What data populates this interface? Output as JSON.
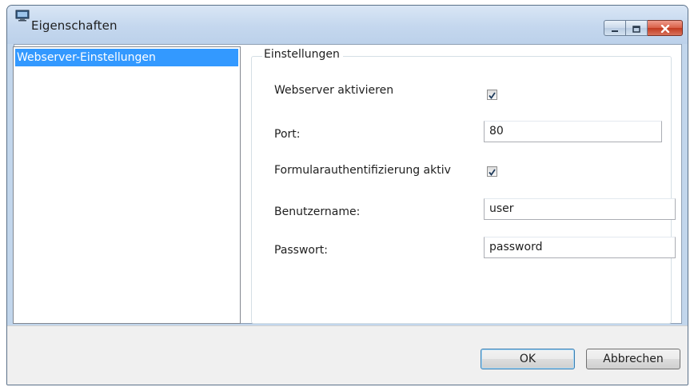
{
  "window": {
    "title": "Eigenschaften",
    "app_icon": "monitor-icon"
  },
  "caption_buttons": {
    "minimize_icon": "minimize-icon",
    "maximize_icon": "maximize-icon",
    "close_icon": "close-icon"
  },
  "nav": {
    "items": [
      {
        "label": "Webserver-Einstellungen",
        "selected": true
      }
    ]
  },
  "settings": {
    "group_title": "Einstellungen",
    "webserver_enabled": {
      "label": "Webserver aktivieren",
      "checked": true
    },
    "port": {
      "label": "Port:",
      "value": "80"
    },
    "form_auth": {
      "label": "Formularauthentifizierung aktiv",
      "checked": true
    },
    "username": {
      "label": "Benutzername:",
      "value": "user"
    },
    "password": {
      "label": "Passwort:",
      "value": "password"
    }
  },
  "footer": {
    "ok_label": "OK",
    "cancel_label": "Abbrechen"
  },
  "colors": {
    "selection": "#3399ff",
    "frame": "#c2d6ec",
    "close_button": "#c23a1f"
  }
}
